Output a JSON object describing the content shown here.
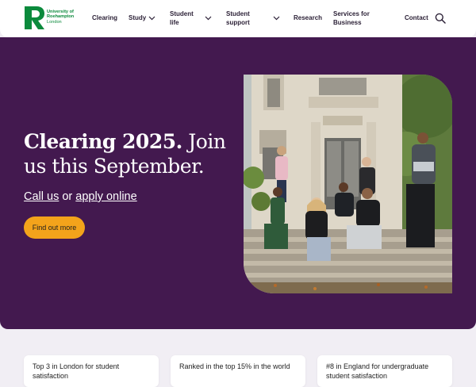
{
  "brand": {
    "line1": "University of",
    "line2": "Roehampton",
    "line3": "London",
    "color": "#0b8a3c"
  },
  "nav": {
    "items": [
      {
        "label": "Clearing",
        "has_dropdown": false
      },
      {
        "label": "Study",
        "has_dropdown": true
      },
      {
        "label": "Student life",
        "has_dropdown": true
      },
      {
        "label": "Student support",
        "has_dropdown": true
      },
      {
        "label": "Research",
        "has_dropdown": false
      },
      {
        "label": "Services for Business",
        "has_dropdown": false
      },
      {
        "label": "Contact",
        "has_dropdown": false
      }
    ],
    "search_icon": "search-icon"
  },
  "hero": {
    "title_strong": "Clearing 2025.",
    "title_soft": "Join us this September.",
    "link_call": "Call us",
    "link_or": "or",
    "link_apply": "apply online",
    "cta_label": "Find out more",
    "background": "#43194f",
    "cta_color": "#f3a31b"
  },
  "stats": [
    {
      "text": "Top 3 in London for student satisfaction"
    },
    {
      "text": "Ranked in the top 15% in the world"
    },
    {
      "text": "#8 in England for undergraduate student satisfaction"
    }
  ]
}
